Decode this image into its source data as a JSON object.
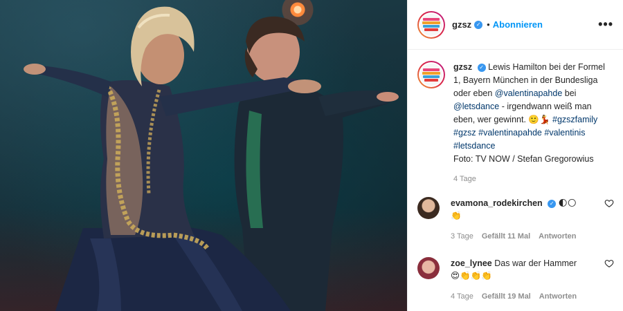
{
  "account": {
    "username": "gzsz",
    "follow_label": "Abonnieren",
    "more_label": "•••"
  },
  "caption": {
    "username": "gzsz",
    "text_1": "Lewis Hamilton bei der Formel 1, Bayern München in der Bundesliga oder eben",
    "mention_1": "@valentinapahde",
    "text_2": "bei",
    "mention_2": "@letsdance",
    "text_3": "- irgendwann weiß man eben, wer gewinnt. 🙂💃",
    "hashtags": [
      "#gzszfamily",
      "#gzsz",
      "#valentinapahde",
      "#valentinis",
      "#letsdance"
    ],
    "credit": "Foto: TV NOW / Stefan Gregorowius",
    "time": "4 Tage"
  },
  "comments": [
    {
      "username": "evamona_rodekirchen",
      "text": "🌓🌕\n👏",
      "time": "3 Tage",
      "likes": "Gefällt 11 Mal",
      "reply": "Antworten"
    },
    {
      "username": "zoe_lynee",
      "text": "Das war der Hammer",
      "emojis": "😍👏👏👏",
      "time": "4 Tage",
      "likes": "Gefällt 19 Mal",
      "reply": "Antworten"
    }
  ],
  "icons": {
    "verified": "verified-badge-icon",
    "heart": "heart-outline-icon",
    "more": "more-horizontal-icon"
  },
  "colors": {
    "link": "#00376b",
    "follow": "#0095f6",
    "verified": "#3897f0",
    "muted": "#8e8e8e"
  }
}
